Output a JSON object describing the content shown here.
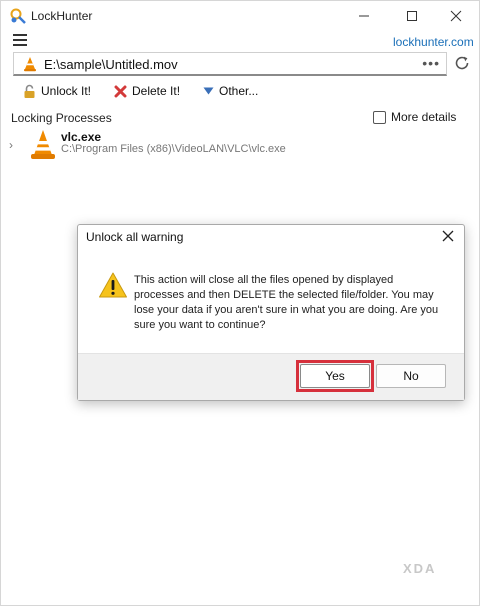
{
  "app": {
    "title": "LockHunter",
    "site_link": "lockhunter.com"
  },
  "path_bar": {
    "value": "E:\\sample\\Untitled.mov",
    "more": "•••"
  },
  "toolbar": {
    "unlock_label": "Unlock It!",
    "delete_label": "Delete It!",
    "other_label": "Other..."
  },
  "processes": {
    "section_title": "Locking Processes",
    "more_details_label": "More details",
    "items": [
      {
        "name": "vlc.exe",
        "path": "C:\\Program Files (x86)\\VideoLAN\\VLC\\vlc.exe"
      }
    ]
  },
  "dialog": {
    "title": "Unlock all warning",
    "message": "This action will close all the files opened by displayed processes and then DELETE the selected file/folder. You may lose your data if you aren't sure in what you are doing. Are you sure you want to continue?",
    "yes_label": "Yes",
    "no_label": "No"
  },
  "watermark": "XDA",
  "colors": {
    "link": "#1a6fb8",
    "highlight": "#d6303c",
    "vlc_orange": "#f08a00"
  }
}
